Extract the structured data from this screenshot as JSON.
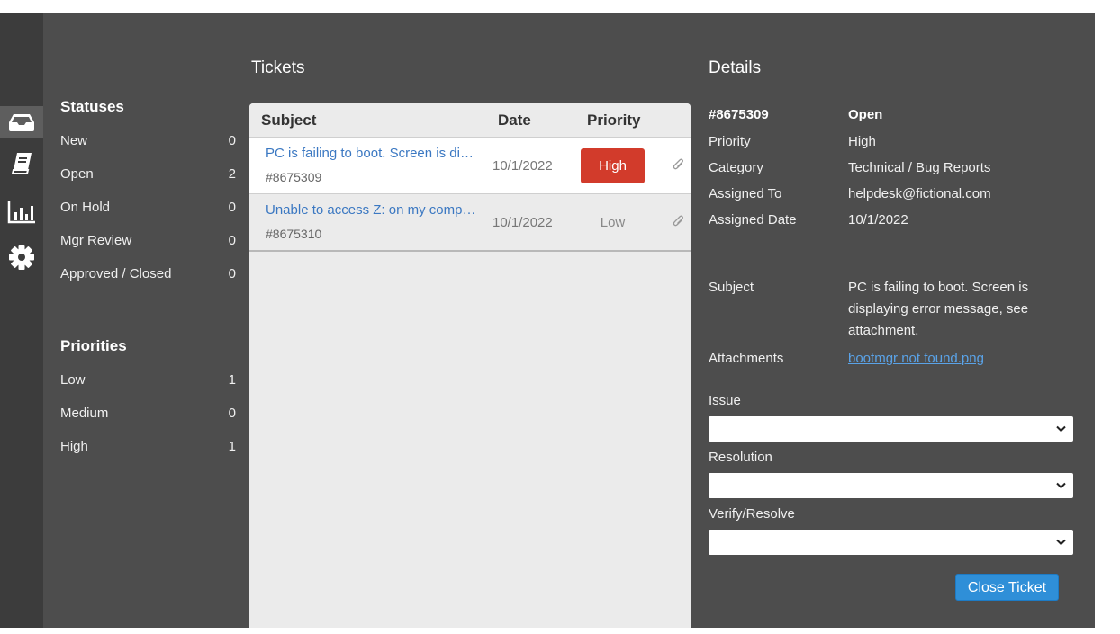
{
  "nav": {
    "items": [
      {
        "icon": "inbox-icon",
        "active": true
      },
      {
        "icon": "book-icon",
        "active": false
      },
      {
        "icon": "bar-chart-icon",
        "active": false
      },
      {
        "icon": "gear-icon",
        "active": false
      }
    ]
  },
  "stats": {
    "statuses_title": "Statuses",
    "statuses": [
      {
        "label": "New",
        "count": "0"
      },
      {
        "label": "Open",
        "count": "2"
      },
      {
        "label": "On Hold",
        "count": "0"
      },
      {
        "label": "Mgr Review",
        "count": "0"
      },
      {
        "label": "Approved / Closed",
        "count": "0"
      }
    ],
    "priorities_title": "Priorities",
    "priorities": [
      {
        "label": "Low",
        "count": "1"
      },
      {
        "label": "Medium",
        "count": "0"
      },
      {
        "label": "High",
        "count": "1"
      }
    ]
  },
  "tickets": {
    "title": "Tickets",
    "columns": {
      "subject": "Subject",
      "date": "Date",
      "priority": "Priority"
    },
    "rows": [
      {
        "subject": "PC is failing to boot. Screen is displaying error message, see attachment.",
        "id": "#8675309",
        "date": "10/1/2022",
        "priority": "High",
        "selected": true
      },
      {
        "subject": "Unable to access Z: on my computer",
        "id": "#8675310",
        "date": "10/1/2022",
        "priority": "Low",
        "selected": false
      }
    ]
  },
  "details": {
    "title": "Details",
    "ticket_id": "#8675309",
    "status": "Open",
    "fields": [
      {
        "label": "Priority",
        "value": "High"
      },
      {
        "label": "Category",
        "value": "Technical / Bug Reports"
      },
      {
        "label": "Assigned To",
        "value": "helpdesk@fictional.com"
      },
      {
        "label": "Assigned Date",
        "value": "10/1/2022"
      }
    ],
    "subject_label": "Subject",
    "subject_value": "PC is failing to boot. Screen is displaying error message, see attachment.",
    "attachments_label": "Attachments",
    "attachment_name": "bootmgr not found.png",
    "issue_label": "Issue",
    "issue_value": "",
    "resolution_label": "Resolution",
    "resolution_value": "",
    "verify_label": "Verify/Resolve",
    "verify_value": "",
    "close_button": "Close Ticket"
  },
  "colors": {
    "background": "#4d4d4d",
    "rail": "#3c3c3c",
    "high_priority": "#d23b2b",
    "link": "#3b78c2",
    "primary_button": "#2f8fd8"
  }
}
